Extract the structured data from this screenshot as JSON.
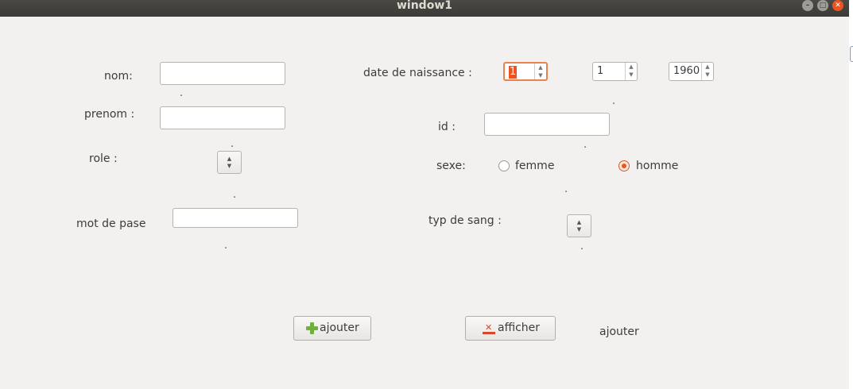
{
  "window": {
    "title": "window1"
  },
  "form": {
    "nom_label": "nom:",
    "nom_value": "",
    "prenom_label": "prenom :",
    "prenom_value": "",
    "role_label": "role :",
    "mot_de_passe_label": "mot de pase",
    "mot_de_passe_value": "",
    "date_label": "date de naissance :",
    "date_day": "1",
    "date_month": "1",
    "date_year": "1960",
    "id_label": "id :",
    "id_value": "",
    "sexe_label": "sexe:",
    "sexe_options": [
      "femme",
      "homme"
    ],
    "sexe_selected": "homme",
    "sang_label": "typ de sang :"
  },
  "separator_dot": ".",
  "buttons": {
    "ajouter_label": "ajouter",
    "afficher_label": "afficher"
  },
  "status_label": "ajouter",
  "icons": {
    "ajouter": "plus-icon",
    "afficher": "download-icon",
    "close": "close-icon",
    "minimize": "minimize-icon",
    "maximize": "maximize-icon"
  },
  "colors": {
    "accent": "#e95420",
    "background": "#f2f1f0",
    "titlebar": "#3c3b37"
  }
}
